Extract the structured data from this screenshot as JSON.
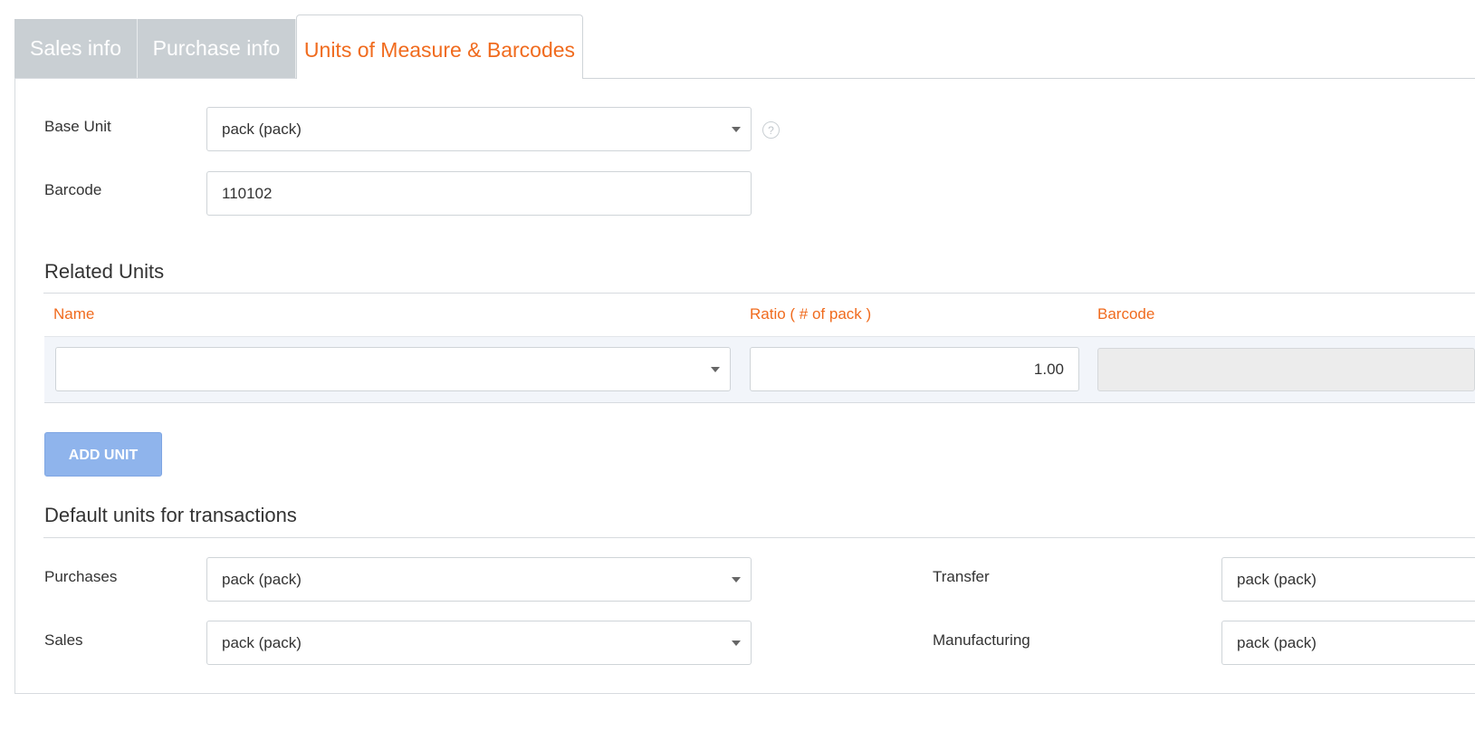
{
  "tabs": [
    {
      "label": "Sales info"
    },
    {
      "label": "Purchase info"
    },
    {
      "label": "Units of Measure & Barcodes"
    }
  ],
  "base_unit": {
    "label": "Base Unit",
    "value": "pack (pack)",
    "help_icon": "?"
  },
  "barcode": {
    "label": "Barcode",
    "value": "110102"
  },
  "related_units": {
    "title": "Related Units",
    "columns": [
      "Name",
      "Ratio ( # of pack )",
      "Barcode"
    ],
    "rows": [
      {
        "name": "",
        "ratio": "1.00",
        "barcode": ""
      }
    ],
    "add_button": "ADD UNIT"
  },
  "defaults": {
    "title": "Default units for transactions",
    "purchases": {
      "label": "Purchases",
      "value": "pack (pack)"
    },
    "sales": {
      "label": "Sales",
      "value": "pack (pack)"
    },
    "transfer": {
      "label": "Transfer",
      "value": "pack (pack)"
    },
    "manufacturing": {
      "label": "Manufacturing",
      "value": "pack (pack)"
    }
  },
  "colors": {
    "accent": "#f06b1e",
    "button": "#8fb4ec",
    "tab_inactive": "#c9cfd3"
  }
}
